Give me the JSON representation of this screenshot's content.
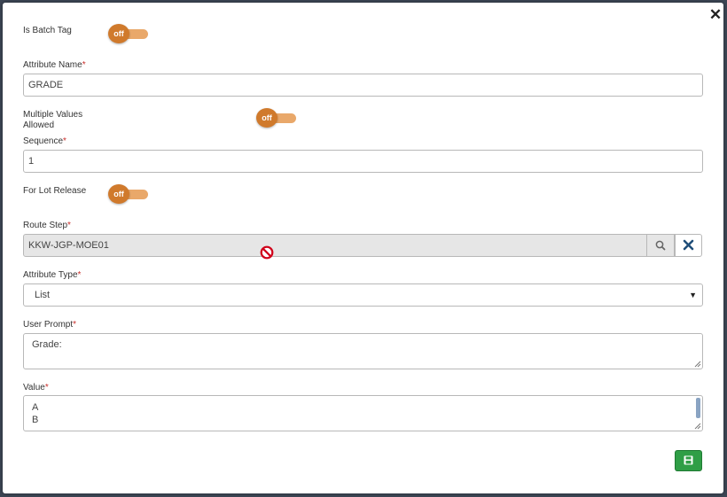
{
  "dialog": {
    "close_glyph": "✕",
    "close_icon": "close-icon"
  },
  "is_batch_tag": {
    "label": "Is Batch Tag",
    "toggle_text": "off",
    "state": "off"
  },
  "attribute_name": {
    "label": "Attribute Name",
    "required_mark": "*",
    "value": "GRADE"
  },
  "multiple_values": {
    "label_line1": "Multiple Values",
    "label_line2": "Allowed",
    "toggle_text": "off",
    "state": "off"
  },
  "sequence": {
    "label": "Sequence",
    "required_mark": "*",
    "value": "1"
  },
  "for_lot_release": {
    "label": "For Lot Release",
    "toggle_text": "off",
    "state": "off"
  },
  "route_step": {
    "label": "Route Step",
    "required_mark": "*",
    "value": "KKW-JGP-MOE01",
    "search_icon": "search-icon",
    "clear_icon": "clear-icon",
    "cursor_icon": "not-allowed-cursor-icon"
  },
  "attribute_type": {
    "label": "Attribute Type",
    "required_mark": "*",
    "selected": "List",
    "arrow": "▼"
  },
  "user_prompt": {
    "label": "User Prompt",
    "required_mark": "*",
    "value": "Grade:"
  },
  "value_field": {
    "label": "Value",
    "required_mark": "*",
    "lines": [
      "A",
      "B"
    ]
  },
  "footer": {
    "save_icon": "floppy-disk-icon"
  },
  "colors": {
    "toggle_knob": "#d07a2c",
    "toggle_track": "#e9a86a",
    "required": "#c9302c",
    "save_button": "#2f9e46",
    "clear_x": "#1f4e79",
    "forbidden": "#d0021b"
  }
}
